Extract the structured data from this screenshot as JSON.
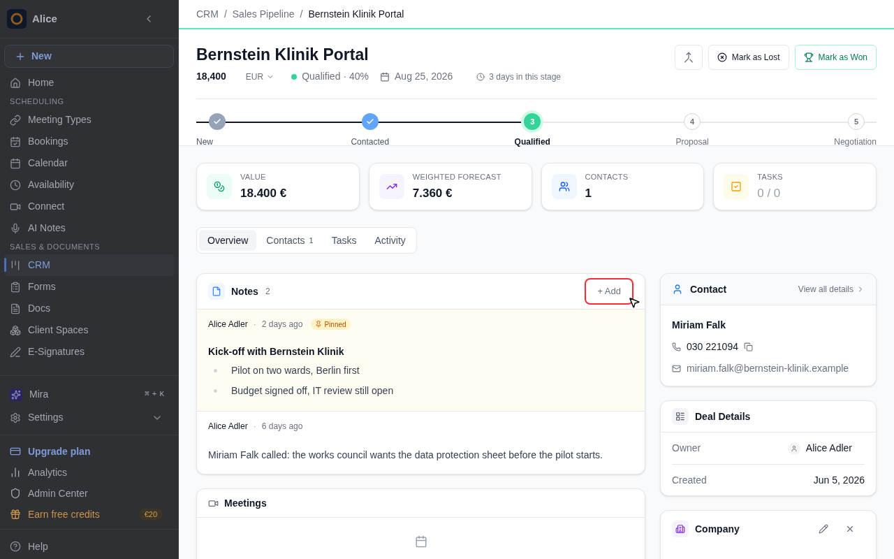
{
  "sidebar": {
    "workspace": "Alice",
    "new_button": "New",
    "groups": [
      {
        "items": [
          {
            "label": "Home",
            "selected": false
          }
        ]
      },
      {
        "heading": "SCHEDULING",
        "items": [
          {
            "label": "Meeting Types",
            "selected": false
          },
          {
            "label": "Bookings",
            "selected": false
          },
          {
            "label": "Calendar",
            "selected": false
          },
          {
            "label": "Availability",
            "selected": false
          },
          {
            "label": "Connect",
            "selected": false
          },
          {
            "label": "AI Notes",
            "selected": false
          }
        ]
      },
      {
        "heading": "SALES & DOCUMENTS",
        "items": [
          {
            "label": "CRM",
            "selected": true
          },
          {
            "label": "Forms",
            "selected": false
          },
          {
            "label": "Docs",
            "selected": false
          },
          {
            "label": "Client Spaces",
            "selected": false
          },
          {
            "label": "E-Signatures",
            "selected": false
          }
        ]
      }
    ],
    "assistant": {
      "label": "Mira",
      "keys": [
        "⌘",
        "+",
        "K"
      ]
    },
    "settings": {
      "label": "Settings",
      "expanded": false
    },
    "footer": [
      {
        "kind": "upgrade",
        "label": "Upgrade plan"
      },
      {
        "kind": "link",
        "label": "Analytics"
      },
      {
        "kind": "link",
        "label": "Admin Center"
      },
      {
        "kind": "credits",
        "label": "Earn free credits",
        "badge": "€20"
      }
    ],
    "help": "Help"
  },
  "breadcrumb": [
    "CRM",
    "Sales Pipeline",
    "Bernstein Klinik Portal"
  ],
  "breadcrumb_separator": "/",
  "deal": {
    "title": "Bernstein Klinik Portal",
    "amount": "18,400",
    "currency": "EUR",
    "stage": "Qualified",
    "probability": "· 40%",
    "color": "#34d399",
    "close_date": "Aug 25, 2026",
    "time_in_stage": "3 days in this stage"
  },
  "actions": [
    {
      "kind": "icon"
    },
    {
      "kind": "lost",
      "label": "Mark as Lost"
    },
    {
      "kind": "won",
      "label": "Mark as Won"
    }
  ],
  "stages": [
    {
      "label": "New",
      "kind": "done",
      "color": "#94a3b8"
    },
    {
      "label": "Contacted",
      "kind": "done",
      "color": "#60a5fa"
    },
    {
      "marker": "3",
      "label": "Qualified",
      "kind": "current",
      "color": "#34d399"
    },
    {
      "marker": "4",
      "label": "Proposal",
      "kind": "upcoming"
    },
    {
      "marker": "5",
      "label": "Negotiation",
      "kind": "upcoming"
    }
  ],
  "stats": [
    {
      "label": "VALUE",
      "value": "18.400 €",
      "muted": false,
      "color": "#ecfdf5"
    },
    {
      "label": "WEIGHTED FORECAST",
      "value": "7.360 €",
      "muted": false,
      "color": "#f5f3ff"
    },
    {
      "label": "CONTACTS",
      "value": "1",
      "muted": false,
      "color": "#eff6ff"
    },
    {
      "label": "TASKS",
      "value": "0 / 0",
      "muted": true,
      "color": "#fefce8"
    }
  ],
  "tabs": [
    {
      "label": "Overview",
      "selected": true
    },
    {
      "label": "Contacts",
      "count": "1",
      "selected": false
    },
    {
      "label": "Tasks",
      "selected": false
    },
    {
      "label": "Activity",
      "selected": false
    }
  ],
  "notes": {
    "title": "Notes",
    "count": "2",
    "add_button": "+ Add",
    "highlighted": true,
    "items": [
      {
        "author": "Alice Adler",
        "separator": "·",
        "time": "2 days ago",
        "pinned": true,
        "badge": "Pinned",
        "title": "Kick-off with Bernstein Klinik",
        "bullets": [
          "Pilot on two wards, Berlin first",
          "Budget signed off, IT review still open"
        ]
      },
      {
        "author": "Alice Adler",
        "separator": "·",
        "time": "6 days ago",
        "pinned": false,
        "text": "Miriam Falk called: the works council wants the data protection sheet before the pilot starts."
      }
    ]
  },
  "meetings": {
    "title": "Meetings"
  },
  "contact": {
    "title": "Contact",
    "link": "View all details",
    "name": "Miriam Falk",
    "phone": "030 221094",
    "email": "miriam.falk@bernstein-klinik.example"
  },
  "deal_details": {
    "title": "Deal Details",
    "rows": [
      {
        "label": "Owner",
        "value": "Alice Adler",
        "kind": "user"
      },
      {
        "label": "Created",
        "value": "Jun 5, 2026",
        "kind": "text"
      }
    ]
  },
  "company": {
    "title": "Company"
  }
}
